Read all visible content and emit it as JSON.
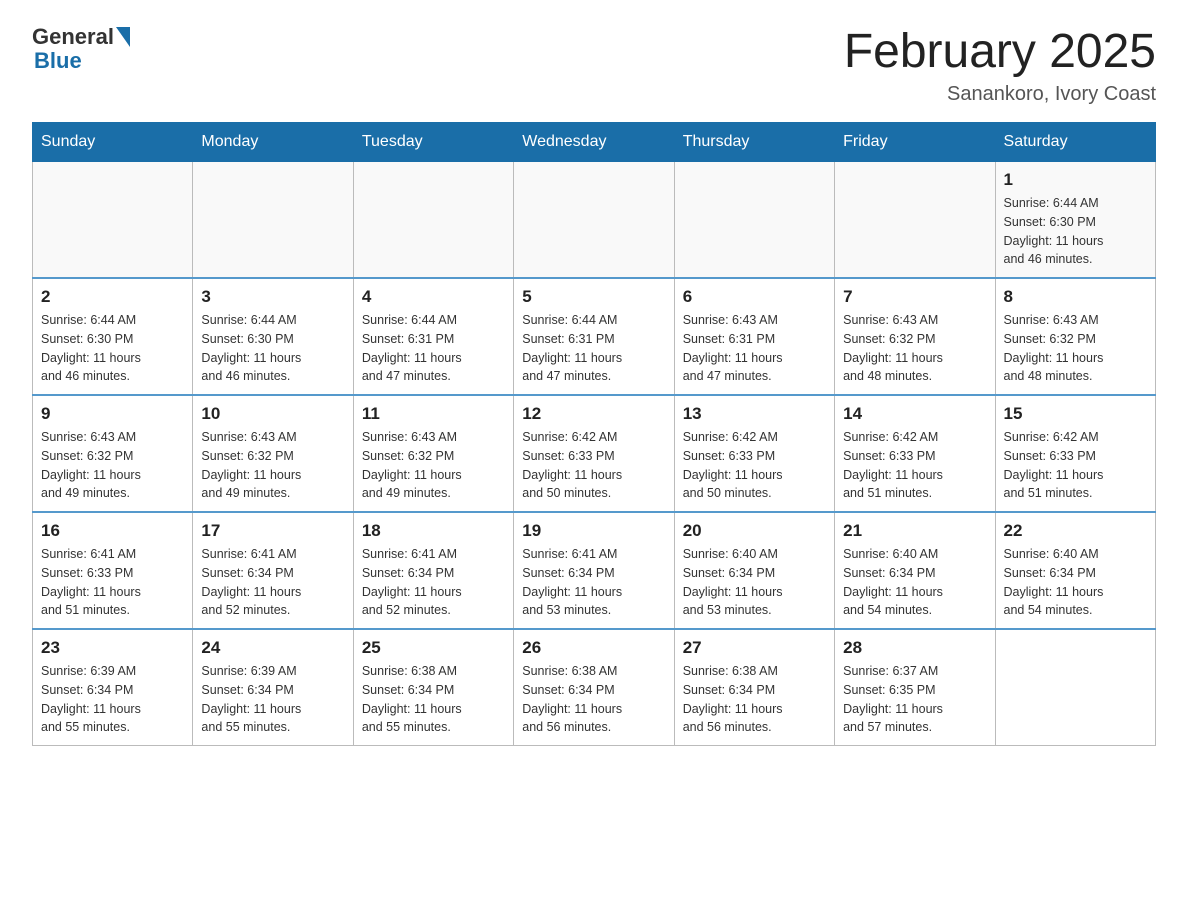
{
  "header": {
    "logo_text": "General",
    "logo_blue": "Blue",
    "main_title": "February 2025",
    "subtitle": "Sanankoro, Ivory Coast"
  },
  "days_of_week": [
    "Sunday",
    "Monday",
    "Tuesday",
    "Wednesday",
    "Thursday",
    "Friday",
    "Saturday"
  ],
  "weeks": [
    [
      {
        "num": "",
        "info": ""
      },
      {
        "num": "",
        "info": ""
      },
      {
        "num": "",
        "info": ""
      },
      {
        "num": "",
        "info": ""
      },
      {
        "num": "",
        "info": ""
      },
      {
        "num": "",
        "info": ""
      },
      {
        "num": "1",
        "info": "Sunrise: 6:44 AM\nSunset: 6:30 PM\nDaylight: 11 hours\nand 46 minutes."
      }
    ],
    [
      {
        "num": "2",
        "info": "Sunrise: 6:44 AM\nSunset: 6:30 PM\nDaylight: 11 hours\nand 46 minutes."
      },
      {
        "num": "3",
        "info": "Sunrise: 6:44 AM\nSunset: 6:30 PM\nDaylight: 11 hours\nand 46 minutes."
      },
      {
        "num": "4",
        "info": "Sunrise: 6:44 AM\nSunset: 6:31 PM\nDaylight: 11 hours\nand 47 minutes."
      },
      {
        "num": "5",
        "info": "Sunrise: 6:44 AM\nSunset: 6:31 PM\nDaylight: 11 hours\nand 47 minutes."
      },
      {
        "num": "6",
        "info": "Sunrise: 6:43 AM\nSunset: 6:31 PM\nDaylight: 11 hours\nand 47 minutes."
      },
      {
        "num": "7",
        "info": "Sunrise: 6:43 AM\nSunset: 6:32 PM\nDaylight: 11 hours\nand 48 minutes."
      },
      {
        "num": "8",
        "info": "Sunrise: 6:43 AM\nSunset: 6:32 PM\nDaylight: 11 hours\nand 48 minutes."
      }
    ],
    [
      {
        "num": "9",
        "info": "Sunrise: 6:43 AM\nSunset: 6:32 PM\nDaylight: 11 hours\nand 49 minutes."
      },
      {
        "num": "10",
        "info": "Sunrise: 6:43 AM\nSunset: 6:32 PM\nDaylight: 11 hours\nand 49 minutes."
      },
      {
        "num": "11",
        "info": "Sunrise: 6:43 AM\nSunset: 6:32 PM\nDaylight: 11 hours\nand 49 minutes."
      },
      {
        "num": "12",
        "info": "Sunrise: 6:42 AM\nSunset: 6:33 PM\nDaylight: 11 hours\nand 50 minutes."
      },
      {
        "num": "13",
        "info": "Sunrise: 6:42 AM\nSunset: 6:33 PM\nDaylight: 11 hours\nand 50 minutes."
      },
      {
        "num": "14",
        "info": "Sunrise: 6:42 AM\nSunset: 6:33 PM\nDaylight: 11 hours\nand 51 minutes."
      },
      {
        "num": "15",
        "info": "Sunrise: 6:42 AM\nSunset: 6:33 PM\nDaylight: 11 hours\nand 51 minutes."
      }
    ],
    [
      {
        "num": "16",
        "info": "Sunrise: 6:41 AM\nSunset: 6:33 PM\nDaylight: 11 hours\nand 51 minutes."
      },
      {
        "num": "17",
        "info": "Sunrise: 6:41 AM\nSunset: 6:34 PM\nDaylight: 11 hours\nand 52 minutes."
      },
      {
        "num": "18",
        "info": "Sunrise: 6:41 AM\nSunset: 6:34 PM\nDaylight: 11 hours\nand 52 minutes."
      },
      {
        "num": "19",
        "info": "Sunrise: 6:41 AM\nSunset: 6:34 PM\nDaylight: 11 hours\nand 53 minutes."
      },
      {
        "num": "20",
        "info": "Sunrise: 6:40 AM\nSunset: 6:34 PM\nDaylight: 11 hours\nand 53 minutes."
      },
      {
        "num": "21",
        "info": "Sunrise: 6:40 AM\nSunset: 6:34 PM\nDaylight: 11 hours\nand 54 minutes."
      },
      {
        "num": "22",
        "info": "Sunrise: 6:40 AM\nSunset: 6:34 PM\nDaylight: 11 hours\nand 54 minutes."
      }
    ],
    [
      {
        "num": "23",
        "info": "Sunrise: 6:39 AM\nSunset: 6:34 PM\nDaylight: 11 hours\nand 55 minutes."
      },
      {
        "num": "24",
        "info": "Sunrise: 6:39 AM\nSunset: 6:34 PM\nDaylight: 11 hours\nand 55 minutes."
      },
      {
        "num": "25",
        "info": "Sunrise: 6:38 AM\nSunset: 6:34 PM\nDaylight: 11 hours\nand 55 minutes."
      },
      {
        "num": "26",
        "info": "Sunrise: 6:38 AM\nSunset: 6:34 PM\nDaylight: 11 hours\nand 56 minutes."
      },
      {
        "num": "27",
        "info": "Sunrise: 6:38 AM\nSunset: 6:34 PM\nDaylight: 11 hours\nand 56 minutes."
      },
      {
        "num": "28",
        "info": "Sunrise: 6:37 AM\nSunset: 6:35 PM\nDaylight: 11 hours\nand 57 minutes."
      },
      {
        "num": "",
        "info": ""
      }
    ]
  ]
}
